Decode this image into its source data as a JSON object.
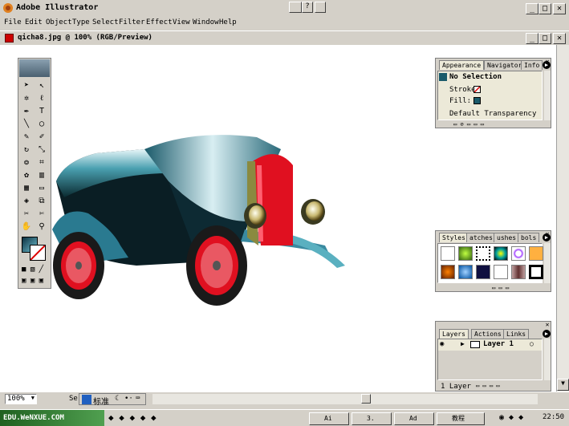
{
  "app": {
    "title": "Adobe Illustrator"
  },
  "menu": [
    "File",
    "Edit",
    "Object",
    "Type",
    "Select",
    "Filter",
    "Effect",
    "View",
    "Window",
    "Help"
  ],
  "document": {
    "title": "qicha8.jpg @ 100% (RGB/Preview)"
  },
  "appearance_panel": {
    "tabs": [
      "Appearance",
      "Navigator",
      "Info"
    ],
    "selection": "No Selection",
    "stroke_label": "Stroke:",
    "fill_label": "Fill:",
    "transparency": "Default Transparency"
  },
  "styles_panel": {
    "tabs": [
      "Styles",
      "Swatches",
      "Brushes",
      "Symbols"
    ],
    "tab_visible_labels": [
      "Styles",
      "atches",
      "ushes",
      "bols"
    ]
  },
  "layers_panel": {
    "tabs": [
      "Layers",
      "Actions",
      "Links"
    ],
    "layer_name": "Layer 1",
    "count_text": "1 Layer"
  },
  "status": {
    "zoom": "100%",
    "label": "Se"
  },
  "ime": {
    "label": "标准"
  },
  "taskbar": {
    "brand": "EDU.WeNXUE.COM",
    "buttons": [
      "Ai",
      "3.",
      "Ad",
      "教程"
    ],
    "clock": "22:50"
  },
  "colors": {
    "window_gray": "#d4d0c8",
    "car_red": "#e01020",
    "car_teal": "#1a5a6a"
  }
}
